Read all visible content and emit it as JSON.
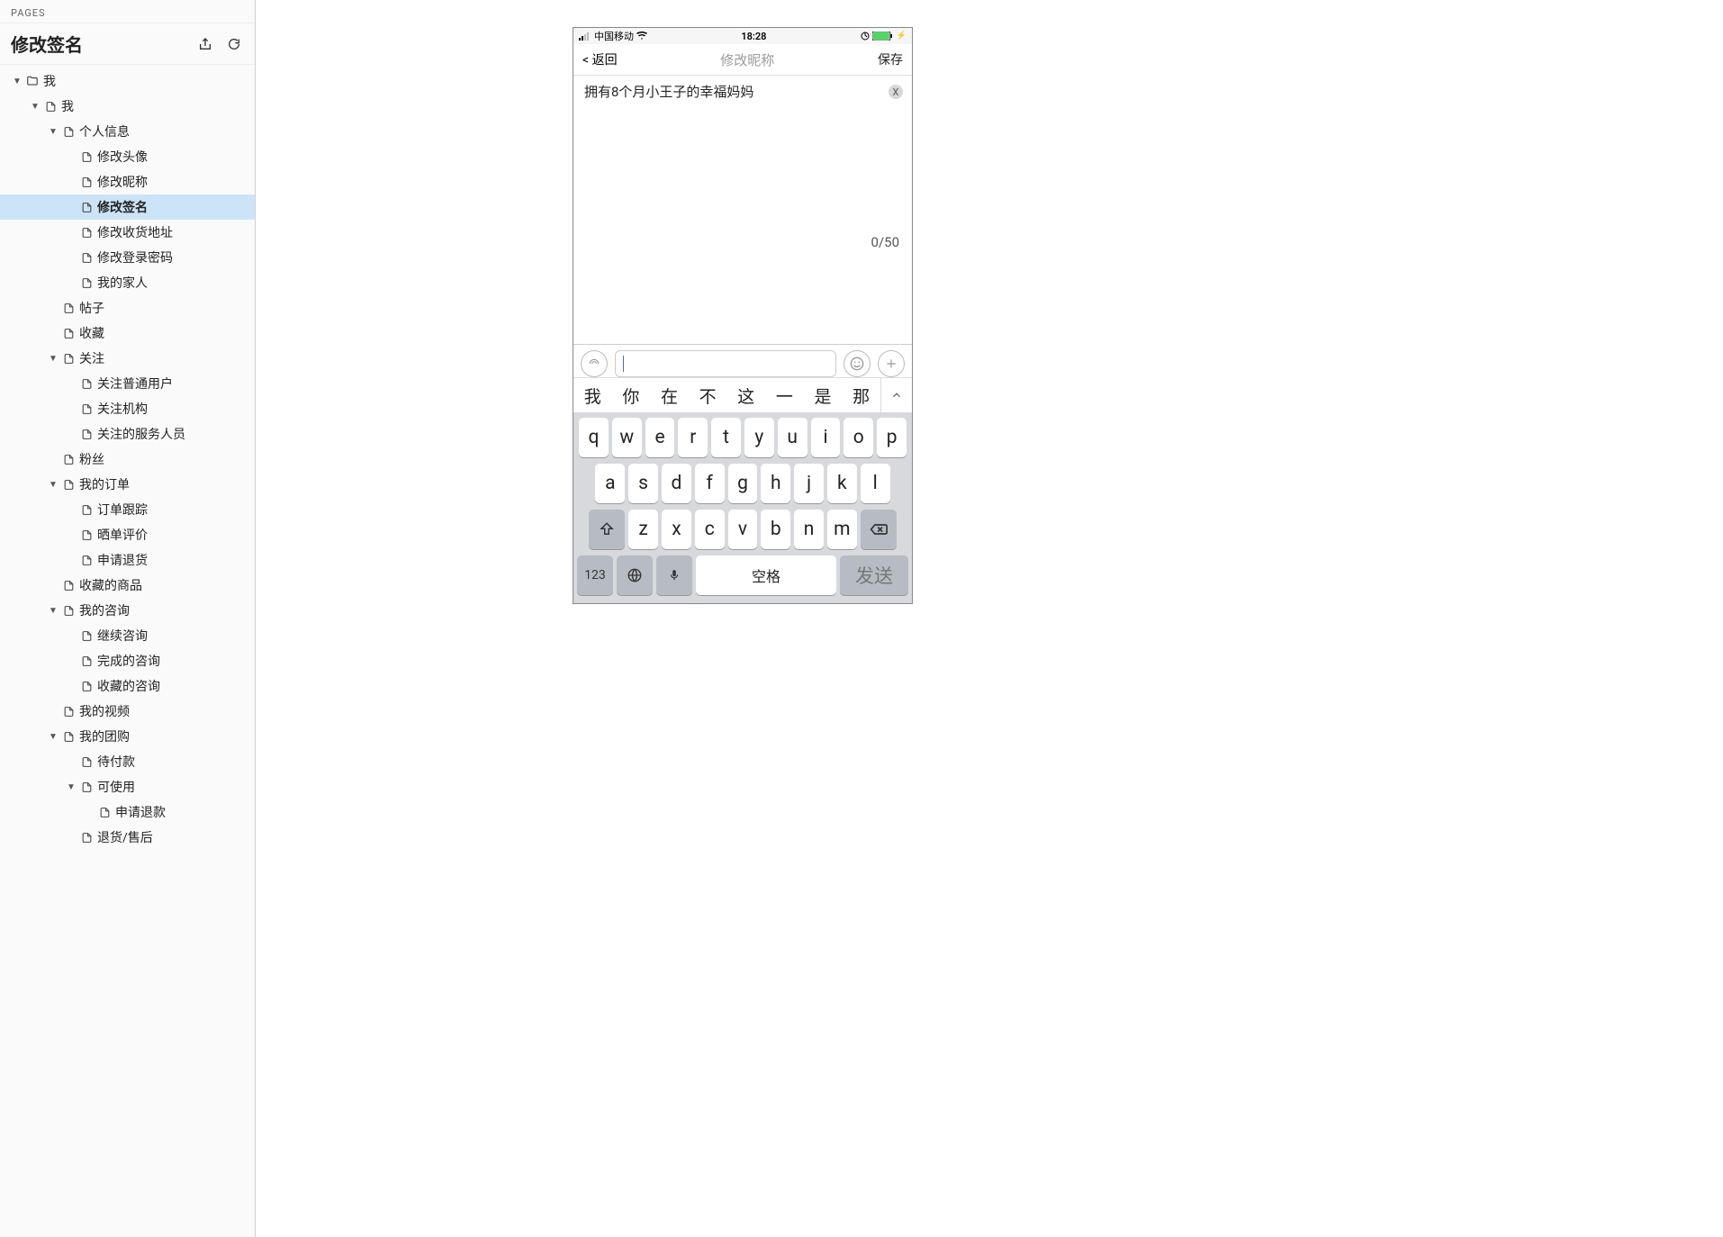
{
  "sidebar": {
    "section_title": "PAGES",
    "page_title": "修改签名",
    "tree": [
      {
        "d": 0,
        "tw": true,
        "folder": true,
        "label": "我"
      },
      {
        "d": 1,
        "tw": true,
        "label": "我"
      },
      {
        "d": 2,
        "tw": true,
        "label": "个人信息"
      },
      {
        "d": 3,
        "label": "修改头像"
      },
      {
        "d": 3,
        "label": "修改昵称"
      },
      {
        "d": 3,
        "label": "修改签名",
        "sel": true
      },
      {
        "d": 3,
        "label": "修改收货地址"
      },
      {
        "d": 3,
        "label": "修改登录密码"
      },
      {
        "d": 3,
        "label": "我的家人"
      },
      {
        "d": 2,
        "label": "帖子"
      },
      {
        "d": 2,
        "label": "收藏"
      },
      {
        "d": 2,
        "tw": true,
        "label": "关注"
      },
      {
        "d": 3,
        "label": "关注普通用户"
      },
      {
        "d": 3,
        "label": "关注机构"
      },
      {
        "d": 3,
        "label": "关注的服务人员"
      },
      {
        "d": 2,
        "label": "粉丝"
      },
      {
        "d": 2,
        "tw": true,
        "label": "我的订单"
      },
      {
        "d": 3,
        "label": "订单跟踪"
      },
      {
        "d": 3,
        "label": "晒单评价"
      },
      {
        "d": 3,
        "label": "申请退货"
      },
      {
        "d": 2,
        "label": "收藏的商品"
      },
      {
        "d": 2,
        "tw": true,
        "label": "我的咨询"
      },
      {
        "d": 3,
        "label": "继续咨询"
      },
      {
        "d": 3,
        "label": "完成的咨询"
      },
      {
        "d": 3,
        "label": "收藏的咨询"
      },
      {
        "d": 2,
        "label": "我的视频"
      },
      {
        "d": 2,
        "tw": true,
        "label": "我的团购"
      },
      {
        "d": 3,
        "label": "待付款"
      },
      {
        "d": 3,
        "tw": true,
        "label": "可使用"
      },
      {
        "d": 4,
        "label": "申请退款"
      },
      {
        "d": 3,
        "label": "退货/售后"
      }
    ]
  },
  "phone": {
    "status": {
      "carrier": "中国移动",
      "time": "18:28"
    },
    "nav": {
      "back": "< 返回",
      "title": "修改昵称",
      "save": "保存"
    },
    "editor": {
      "value": "拥有8个月小王子的幸福妈妈",
      "counter": "0/50",
      "clear": "X"
    },
    "candidates": [
      "我",
      "你",
      "在",
      "不",
      "这",
      "一",
      "是",
      "那"
    ],
    "row1": [
      "q",
      "w",
      "e",
      "r",
      "t",
      "y",
      "u",
      "i",
      "o",
      "p"
    ],
    "row2": [
      "a",
      "s",
      "d",
      "f",
      "g",
      "h",
      "j",
      "k",
      "l"
    ],
    "row3": [
      "z",
      "x",
      "c",
      "v",
      "b",
      "n",
      "m"
    ],
    "row4": {
      "num": "123",
      "space": "空格",
      "send": "发送"
    }
  }
}
